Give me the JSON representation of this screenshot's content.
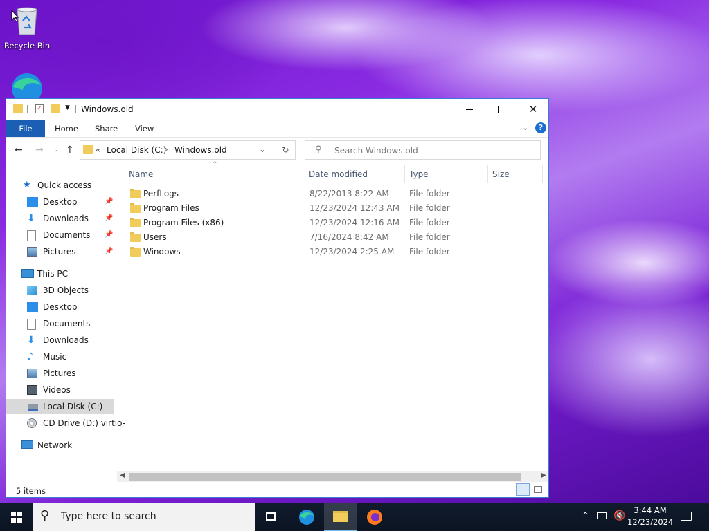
{
  "desktop": {
    "icons": [
      {
        "label": "Recycle Bin",
        "icon": "recycle-bin-icon"
      },
      {
        "label": "",
        "icon": "edge-icon"
      }
    ]
  },
  "window": {
    "title": "Windows.old",
    "accent": "#1a5fb4",
    "ribbon_tabs": [
      "File",
      "Home",
      "Share",
      "View"
    ],
    "address": {
      "crumbs": [
        "Local Disk (C:)",
        "Windows.old"
      ],
      "overflow": "«"
    },
    "search_placeholder": "Search Windows.old",
    "sidebar": {
      "quick_access": {
        "label": "Quick access",
        "items": [
          "Desktop",
          "Downloads",
          "Documents",
          "Pictures"
        ]
      },
      "this_pc": {
        "label": "This PC",
        "items": [
          "3D Objects",
          "Desktop",
          "Documents",
          "Downloads",
          "Music",
          "Pictures",
          "Videos",
          "Local Disk (C:)",
          "CD Drive (D:) virtio-"
        ]
      },
      "network": {
        "label": "Network"
      },
      "selected": "Local Disk (C:)"
    },
    "columns": [
      "Name",
      "Date modified",
      "Type",
      "Size"
    ],
    "files": [
      {
        "name": "PerfLogs",
        "date": "8/22/2013 8:22 AM",
        "type": "File folder",
        "size": ""
      },
      {
        "name": "Program Files",
        "date": "12/23/2024 12:43 AM",
        "type": "File folder",
        "size": ""
      },
      {
        "name": "Program Files (x86)",
        "date": "12/23/2024 12:16 AM",
        "type": "File folder",
        "size": ""
      },
      {
        "name": "Users",
        "date": "7/16/2024 8:42 AM",
        "type": "File folder",
        "size": ""
      },
      {
        "name": "Windows",
        "date": "12/23/2024 2:25 AM",
        "type": "File folder",
        "size": ""
      }
    ],
    "status": "5 items"
  },
  "taskbar": {
    "search_placeholder": "Type here to search",
    "time": "3:44 AM",
    "date": "12/23/2024"
  }
}
